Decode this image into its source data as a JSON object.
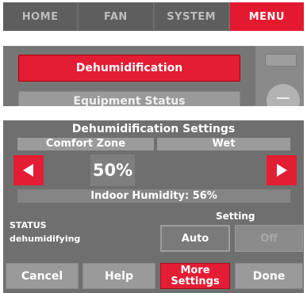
{
  "tabs": [
    "HOME",
    "FAN",
    "SYSTEM",
    "MENU"
  ],
  "active_tab": "MENU",
  "menu": {
    "items": [
      {
        "label": "Dehumidification",
        "selected": true
      },
      {
        "label": "Equipment Status",
        "selected": false
      }
    ]
  },
  "settings": {
    "title": "Dehumidification Settings",
    "modes": [
      "Comfort Zone",
      "Wet"
    ],
    "value": "50%",
    "indoor_humidity": "Indoor Humidity: 56%",
    "status_label": "STATUS",
    "status_value": "dehumidifying",
    "setting_label": "Setting",
    "setting_options": [
      "Auto",
      "Off"
    ],
    "selected_setting": "Auto",
    "buttons": {
      "cancel": "Cancel",
      "help": "Help",
      "more_settings_line1": "More",
      "more_settings_line2": "Settings",
      "done": "Done"
    }
  },
  "colors": {
    "accent_red": "#e31d34",
    "panel_gray": "#6f6f6f",
    "button_gray": "#9a9a9a"
  }
}
